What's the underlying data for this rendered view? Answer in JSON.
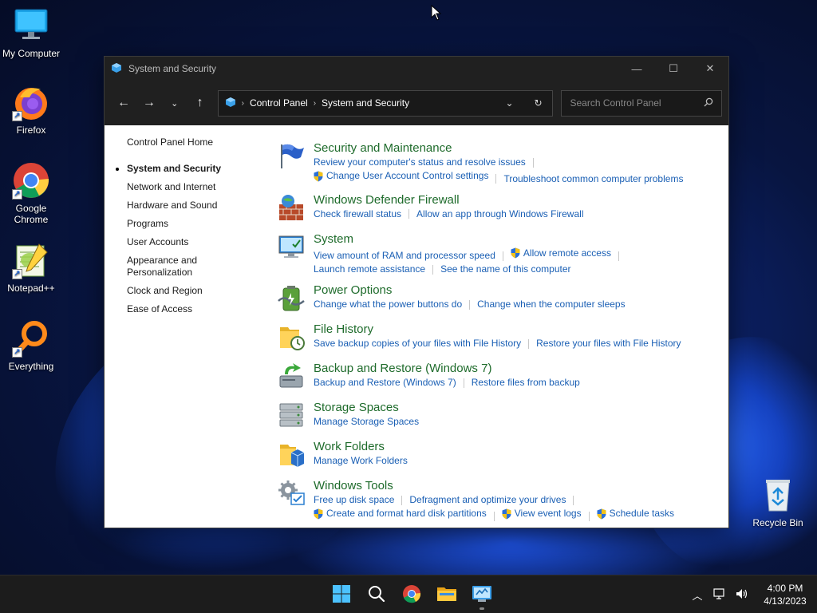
{
  "desktop": {
    "icons": [
      {
        "label": "My Computer"
      },
      {
        "label": "Firefox"
      },
      {
        "label": "Google Chrome"
      },
      {
        "label": "Notepad++"
      },
      {
        "label": "Everything"
      },
      {
        "label": "Recycle Bin"
      }
    ]
  },
  "window": {
    "title": "System and Security",
    "address": {
      "crumbs": [
        "Control Panel",
        "System and Security"
      ]
    },
    "search_placeholder": "Search Control Panel",
    "leftnav": [
      "Control Panel Home",
      "System and Security",
      "Network and Internet",
      "Hardware and Sound",
      "Programs",
      "User Accounts",
      "Appearance and Personalization",
      "Clock and Region",
      "Ease of Access"
    ],
    "sections": [
      {
        "title": "Security and Maintenance",
        "icon": "flag-icon",
        "lines": [
          [
            {
              "text": "Review your computer's status and resolve issues",
              "shield": false
            }
          ],
          [
            {
              "text": "Change User Account Control settings",
              "shield": true
            },
            {
              "text": "Troubleshoot common computer problems",
              "shield": false
            }
          ]
        ]
      },
      {
        "title": "Windows Defender Firewall",
        "icon": "firewall-icon",
        "lines": [
          [
            {
              "text": "Check firewall status",
              "shield": false
            },
            {
              "text": "Allow an app through Windows Firewall",
              "shield": false
            }
          ]
        ]
      },
      {
        "title": "System",
        "icon": "system-monitor-icon",
        "lines": [
          [
            {
              "text": "View amount of RAM and processor speed",
              "shield": false
            },
            {
              "text": "Allow remote access",
              "shield": true
            }
          ],
          [
            {
              "text": "Launch remote assistance",
              "shield": false
            },
            {
              "text": "See the name of this computer",
              "shield": false
            }
          ]
        ]
      },
      {
        "title": "Power Options",
        "icon": "power-battery-icon",
        "lines": [
          [
            {
              "text": "Change what the power buttons do",
              "shield": false
            },
            {
              "text": "Change when the computer sleeps",
              "shield": false
            }
          ]
        ]
      },
      {
        "title": "File History",
        "icon": "file-history-icon",
        "lines": [
          [
            {
              "text": "Save backup copies of your files with File History",
              "shield": false
            },
            {
              "text": "Restore your files with File History",
              "shield": false
            }
          ]
        ]
      },
      {
        "title": "Backup and Restore (Windows 7)",
        "icon": "backup-restore-icon",
        "lines": [
          [
            {
              "text": "Backup and Restore (Windows 7)",
              "shield": false
            },
            {
              "text": "Restore files from backup",
              "shield": false
            }
          ]
        ]
      },
      {
        "title": "Storage Spaces",
        "icon": "storage-spaces-icon",
        "lines": [
          [
            {
              "text": "Manage Storage Spaces",
              "shield": false
            }
          ]
        ]
      },
      {
        "title": "Work Folders",
        "icon": "work-folders-icon",
        "lines": [
          [
            {
              "text": "Manage Work Folders",
              "shield": false
            }
          ]
        ]
      },
      {
        "title": "Windows Tools",
        "icon": "windows-tools-icon",
        "lines": [
          [
            {
              "text": "Free up disk space",
              "shield": false
            },
            {
              "text": "Defragment and optimize your drives",
              "shield": false
            }
          ],
          [
            {
              "text": "Create and format hard disk partitions",
              "shield": true
            },
            {
              "text": "View event logs",
              "shield": true
            },
            {
              "text": "Schedule tasks",
              "shield": true
            }
          ]
        ]
      }
    ]
  },
  "taskbar": {
    "apps": [
      "start-icon",
      "search-icon",
      "chrome-icon",
      "file-explorer-icon",
      "control-panel-icon"
    ],
    "clock": {
      "time": "4:00 PM",
      "date": "4/13/2023"
    }
  },
  "colors": {
    "link": "#1a5fb4",
    "heading": "#1e6b2b",
    "chrome": "#202020"
  }
}
